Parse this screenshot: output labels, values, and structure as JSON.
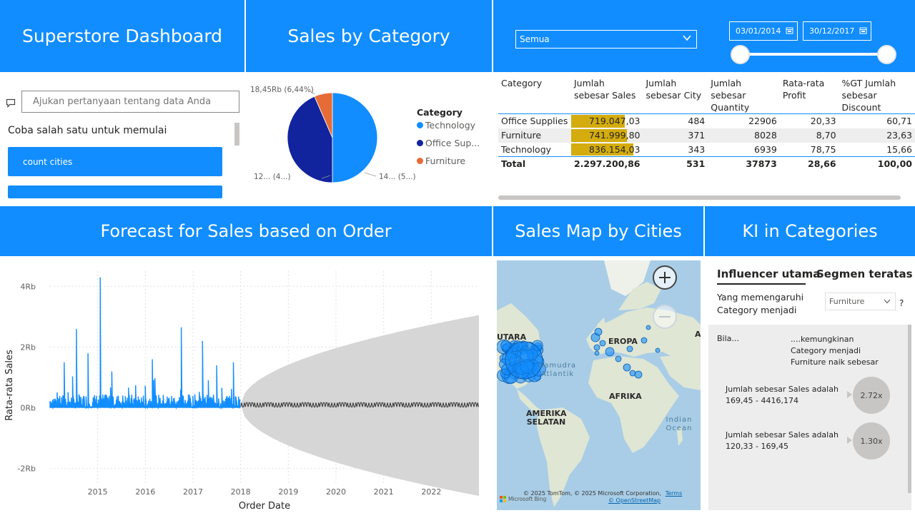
{
  "headers": {
    "dashboard_title": "Superstore Dashboard",
    "sales_by_category": "Sales by Category",
    "forecast": "Forecast for Sales based on Order",
    "sales_map": "Sales Map by Cities",
    "ki": "KI in Categories"
  },
  "filter": {
    "dropdown_value": "Semua",
    "date_start": "03/01/2014",
    "date_end": "30/12/2017"
  },
  "qa": {
    "placeholder": "Ajukan pertanyaan tentang data Anda",
    "prompt": "Coba salah satu untuk memulai",
    "suggestions": [
      "count cities",
      ""
    ]
  },
  "pie": {
    "legend_title": "Category",
    "legend_items": [
      "Technology",
      "Office Sup...",
      "Furniture"
    ],
    "label_top": "18,45Rb (6,44%)",
    "label_left": "12... (4...)",
    "label_right": "14... (5...)"
  },
  "matrix": {
    "headers": [
      "Category",
      "Jumlah sebesar Sales",
      "Jumlah sebesar City",
      "Jumlah sebesar Quantity",
      "Rata-rata Profit",
      "%GT Jumlah sebesar Discount"
    ],
    "rows": [
      {
        "category": "Office Supplies",
        "sales": "719.047,03",
        "sales_fraction": 0.86,
        "city": "484",
        "quantity": "22906",
        "profit": "20,33",
        "discount": "60,71"
      },
      {
        "category": "Furniture",
        "sales": "741.999,80",
        "sales_fraction": 0.89,
        "city": "371",
        "quantity": "8028",
        "profit": "8,70",
        "discount": "23,63"
      },
      {
        "category": "Technology",
        "sales": "836.154,03",
        "sales_fraction": 1.0,
        "city": "343",
        "quantity": "6939",
        "profit": "78,75",
        "discount": "15,66"
      }
    ],
    "total": {
      "category": "Total",
      "sales": "2.297.200,86",
      "city": "531",
      "quantity": "37873",
      "profit": "28,66",
      "discount": "100,00"
    }
  },
  "map": {
    "labels": [
      "UTARA",
      "EROPA",
      "AFRIKA",
      "AMERIKA SELATAN",
      "A"
    ],
    "ocean_atlantic": "Samudra Atlantik",
    "ocean_indian": "Indian Ocean",
    "attribution": "© 2025 TomTom, © 2025 Microsoft Corporation,",
    "terms": "Terms",
    "osm": "© OpenStreetMap",
    "bing": "Microsoft Bing"
  },
  "ki": {
    "tab_active": "Influencer utama",
    "tab_other": "Segmen teratas",
    "question": "Yang memengaruhi Category menjadi",
    "select_value": "Furniture",
    "help": "?",
    "col_when": "Bila...",
    "col_likelihood": "....kemungkinan Category menjadi Furniture naik sebesar",
    "influencers": [
      {
        "text": "Jumlah sebesar Sales adalah 169,45 - 4416,174",
        "value": "2.72x",
        "multiplier": 2.72
      },
      {
        "text": "Jumlah sebesar Sales adalah 120,33 - 169,45",
        "value": "1.30x",
        "multiplier": 1.3
      }
    ]
  },
  "colors": {
    "accent": "#118DFF",
    "technology": "#118DFF",
    "office_supplies": "#12239E",
    "furniture": "#E66C37",
    "bar_highlight": "#D4AC0D",
    "forecast_band": "#d6d6d6"
  },
  "chart_data": [
    {
      "type": "pie",
      "categories": [
        "Technology",
        "Office Supplies",
        "Furniture"
      ],
      "values": [
        836154.03,
        719047.03,
        741999.8
      ],
      "displayed_labels": [
        "14... (5...)",
        "12... (4...)",
        "18,45Rb (6,44%)"
      ],
      "legend_title": "Category",
      "legend": "right"
    },
    {
      "type": "line",
      "title": "",
      "xlabel": "Order Date",
      "ylabel": "Rata-rata Sales",
      "x_ticks": [
        "2015",
        "2016",
        "2017",
        "2018",
        "2019",
        "2020",
        "2021",
        "2022"
      ],
      "y_ticks": [
        "4Rb",
        "2Rb",
        "0Rb",
        "-2Rb"
      ],
      "ylim": [
        -2500,
        4500
      ],
      "xlim": [
        2014.0,
        2023.0
      ],
      "series": [
        {
          "values_note": "actual daily average sales 2014-2017, mostly 0-600 with spikes",
          "spikes": [
            [
              2014.3,
              1500
            ],
            [
              2014.55,
              2600
            ],
            [
              2014.8,
              1800
            ],
            [
              2015.05,
              4300
            ],
            [
              2015.3,
              1200
            ],
            [
              2016.15,
              1600
            ],
            [
              2016.75,
              2650
            ],
            [
              2017.2,
              2200
            ],
            [
              2017.5,
              1400
            ],
            [
              2017.85,
              1500
            ]
          ]
        },
        {
          "forecast": true,
          "start": 2018.0,
          "end": 2023.0,
          "center": 100,
          "band_upper_end": 3050,
          "band_lower_end": -2900
        }
      ]
    }
  ]
}
